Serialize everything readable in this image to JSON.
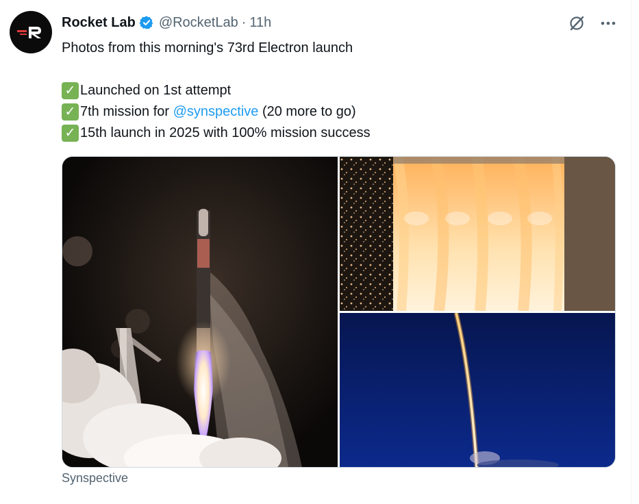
{
  "tweet": {
    "author_name": "Rocket Lab",
    "handle": "@RocketLab",
    "separator": "·",
    "time": "11h",
    "lines": [
      "Photos from this morning's 73rd Electron launch",
      "",
      "Launched on 1st attempt",
      "7th mission for ",
      "15th launch in 2025 with 100% mission success"
    ],
    "mention": "@synspective",
    "mention_suffix": " (20 more to go)",
    "check_glyph": "✓"
  },
  "media": {
    "caption": "Synspective"
  },
  "icons": {
    "verified": "verified-badge-icon",
    "grok": "grok-icon",
    "more": "more-options-icon"
  },
  "colors": {
    "accent": "#1d9bf0",
    "text": "#0f1419",
    "muted": "#536471",
    "check": "#77b255"
  }
}
